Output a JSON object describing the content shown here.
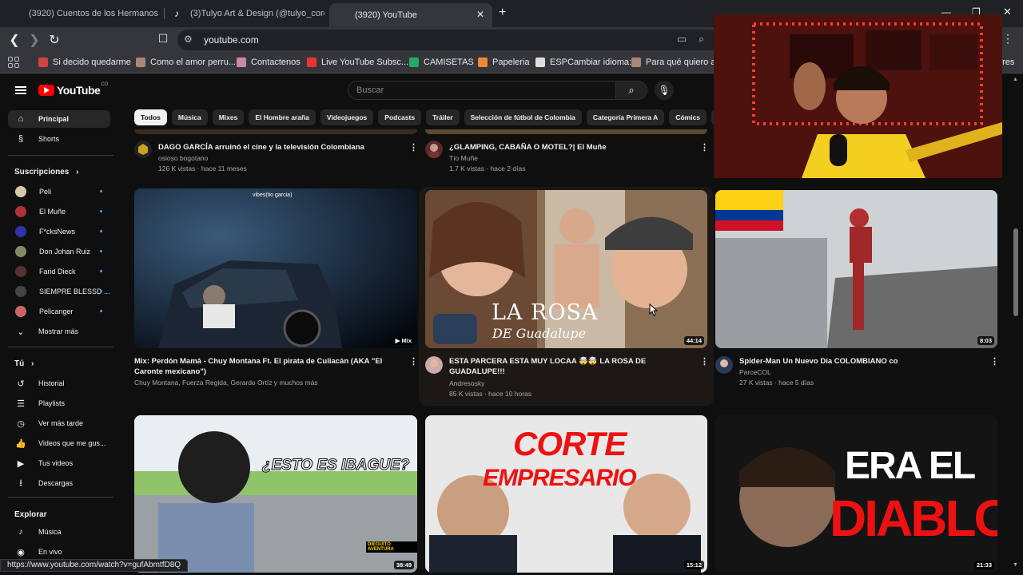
{
  "browser": {
    "tabs": [
      {
        "label": "(3920) Cuentos de los Hermanos Grim",
        "icon": "youtube-icon"
      },
      {
        "label": "(3)Tulyo Art & Design (@tulyo_coron",
        "icon": "tiktok-icon"
      },
      {
        "label": "(3920) YouTube",
        "icon": "youtube-icon",
        "active": true
      }
    ],
    "url": "youtube.com",
    "bookmarks": [
      {
        "label": "Si decido quedarme",
        "color": "#c44"
      },
      {
        "label": "Como el amor perru...",
        "color": "#a87"
      },
      {
        "label": "Contactenos",
        "color": "#c8a"
      },
      {
        "label": "Live YouTube Subsc...",
        "color": "#e33"
      },
      {
        "label": "CAMISETAS",
        "color": "#2a6"
      },
      {
        "label": "Papeleria",
        "color": "#e83"
      },
      {
        "label": "ESPCambiar idioma:",
        "color": "#ddd"
      },
      {
        "label": "Para qué quiero asp",
        "color": "#a87"
      }
    ],
    "bookmarks_tail": "ores",
    "status_url": "https://www.youtube.com/watch?v=gufAbmtfD8Q"
  },
  "youtube": {
    "logo_text": "YouTube",
    "logo_region": "CO",
    "search_placeholder": "Buscar",
    "sidebar": {
      "main": [
        {
          "label": "Principal",
          "icon": "home-icon",
          "active": true
        },
        {
          "label": "Shorts",
          "icon": "shorts-icon"
        }
      ],
      "subscriptions_title": "Suscripciones",
      "subscriptions": [
        {
          "label": "Peli",
          "color": "#d9c9a8"
        },
        {
          "label": "El Muñe",
          "color": "#a33"
        },
        {
          "label": "F*cksNews",
          "color": "#33a"
        },
        {
          "label": "Don Johan Ruiz",
          "color": "#886"
        },
        {
          "label": "Farid Dieck",
          "color": "#533"
        },
        {
          "label": "SIEMPRE BLESSD ...",
          "color": "#444"
        },
        {
          "label": "Pelicanger",
          "color": "#c66"
        }
      ],
      "show_more": "Mostrar más",
      "you_title": "Tú",
      "you_items": [
        {
          "label": "Historial",
          "icon": "history-icon"
        },
        {
          "label": "Playlists",
          "icon": "playlists-icon"
        },
        {
          "label": "Ver más tarde",
          "icon": "watch-later-icon"
        },
        {
          "label": "Videos que me gus...",
          "icon": "like-icon"
        },
        {
          "label": "Tus videos",
          "icon": "your-videos-icon"
        },
        {
          "label": "Descargas",
          "icon": "download-icon"
        }
      ],
      "explore_title": "Explorar",
      "explore_items": [
        {
          "label": "Música",
          "icon": "music-icon"
        },
        {
          "label": "En vivo",
          "icon": "live-icon"
        }
      ]
    },
    "chips": [
      "Todos",
      "Música",
      "Mixes",
      "El Hombre araña",
      "Videojuegos",
      "Podcasts",
      "Tráiler",
      "Selección de fútbol de Colombia",
      "Categoría Primera A",
      "Cómics",
      "S"
    ],
    "prev_row": [
      {
        "title": "DAGO GARCÍA arruinó el cine y la televisión Colombiana",
        "channel": "osioso bogotano",
        "stats": "126 K vistas · hace 11 meses"
      },
      {
        "title": "¿GLAMPING, CABAÑA O MOTEL?| El Muñe",
        "channel": "Tío Muñe",
        "stats": "1.7 K vistas · hace 2 días"
      }
    ],
    "row1": [
      {
        "title": "Mix: Perdón Mamá - Chuy Montana Ft. El pirata de Culiacán (AKA \"El Caronte mexicano\")",
        "channel": "Chuy Montana, Fuerza Regida, Gerardo Ortíz y muchos más",
        "stats": "",
        "badge": "Mix",
        "overlay": "vibes(tio garcia)"
      },
      {
        "title": "ESTA PARCERA ESTA MUY LOCAA 🤯🤯 LA ROSA DE GUADALUPE!!!",
        "channel": "Andresosky",
        "stats": "85 K vistas · hace 10 horas",
        "duration": "44:14",
        "overlay_big": "LA ROSA",
        "overlay_small": "DE Guadalupe"
      },
      {
        "title": "Spider-Man Un Nuevo Día COLOMBIANO co",
        "channel": "ParceCOL",
        "stats": "27 K vistas · hace 5 días",
        "duration": "8:03"
      }
    ],
    "row2": [
      {
        "duration": "38:49",
        "overlay": "¿ESTO ES IBAGUE?",
        "tag": "DIEGUITO AVENTURA"
      },
      {
        "duration": "15:12",
        "overlay_line1": "CORTE",
        "overlay_line2": "EMPRESARIO"
      },
      {
        "duration": "21:33",
        "overlay_line1": "ERA EL",
        "overlay_line2": "DIABLO"
      }
    ]
  }
}
